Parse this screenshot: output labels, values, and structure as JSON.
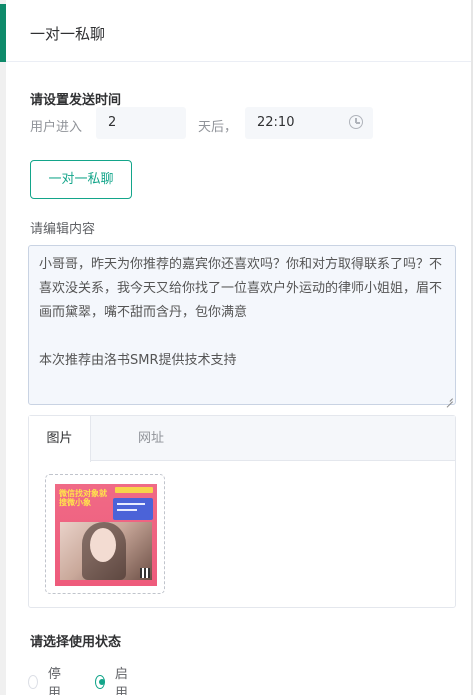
{
  "header": {
    "title": "一对一私聊"
  },
  "send_time": {
    "section_label": "请设置发送时间",
    "prefix_label": "用户进入",
    "days_value": "2",
    "suffix_label": "天后，",
    "time_value": "22:10",
    "time_icon": "clock-icon"
  },
  "mode_button": {
    "label": "一对一私聊"
  },
  "content": {
    "section_label": "请编辑内容",
    "paragraphs": [
      "小哥哥，昨天为你推荐的嘉宾你还喜欢吗？你和对方取得联系了吗？不喜欢没关系，我今天又给你找了一位喜欢户外运动的律师小姐姐，眉不画而黛翠，嘴不甜而含丹，包你满意",
      "",
      "本次推荐由洛书SMR提供技术支持"
    ]
  },
  "media_tabs": {
    "tabs": [
      "图片",
      "网址"
    ],
    "active": "图片"
  },
  "poster": {
    "headline": "微信找对象就搜微小象",
    "colors": {
      "background": "#ee5b7c",
      "card": "#4b63d8",
      "headline": "#ffe14d"
    }
  },
  "status": {
    "section_label": "请选择使用状态",
    "options": [
      {
        "label": "停用",
        "checked": false
      },
      {
        "label": "启用",
        "checked": true
      }
    ]
  },
  "colors": {
    "accent": "#13a58a",
    "sidebar_accent": "#0e8a6a"
  }
}
